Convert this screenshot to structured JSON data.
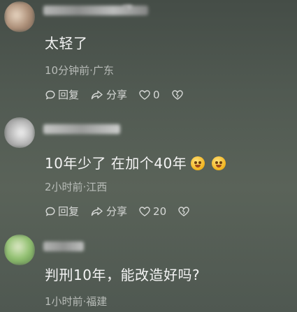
{
  "comments": [
    {
      "text": "太轻了",
      "meta": "10分钟前·广东",
      "reply_label": "回复",
      "share_label": "分享",
      "like_count": "0"
    },
    {
      "text": "10年少了 在加个40年",
      "emoji_count": 2,
      "meta": "2小时前·江西",
      "reply_label": "回复",
      "share_label": "分享",
      "like_count": "20"
    },
    {
      "text": "判刑10年，能改造好吗?",
      "meta": "1小时前·福建"
    }
  ],
  "colors": {
    "background": "#515a52",
    "text": "#f4f4f4",
    "meta": "#b8bcb8",
    "emoji": "#f2b21c"
  }
}
